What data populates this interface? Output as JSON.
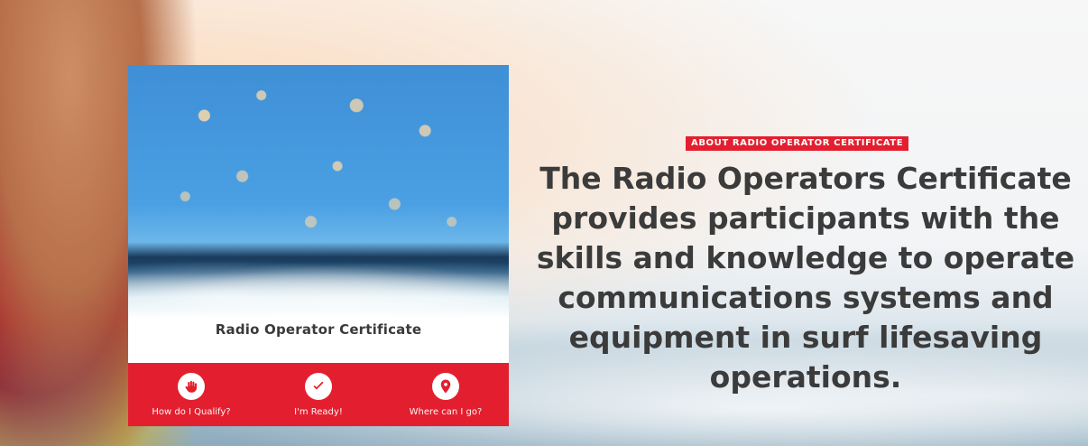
{
  "colors": {
    "accent_red": "#E31F2F",
    "headline_text": "#3B3B3B",
    "card_title_text": "#3A3A3A"
  },
  "hero": {
    "badge": "ABOUT RADIO OPERATOR CERTIFICATE",
    "headline_lines": [
      "The Radio Operators Certificate",
      "provides participants with the",
      "skills and knowledge to operate",
      "communications systems and",
      "equipment in surf lifesaving",
      "operations."
    ]
  },
  "card": {
    "title": "Radio Operator Certificate",
    "actions": [
      {
        "label": "How do I Qualify?",
        "icon": "hand-icon"
      },
      {
        "label": "I'm Ready!",
        "icon": "check-icon"
      },
      {
        "label": "Where can I go?",
        "icon": "location-pin-icon"
      }
    ]
  }
}
